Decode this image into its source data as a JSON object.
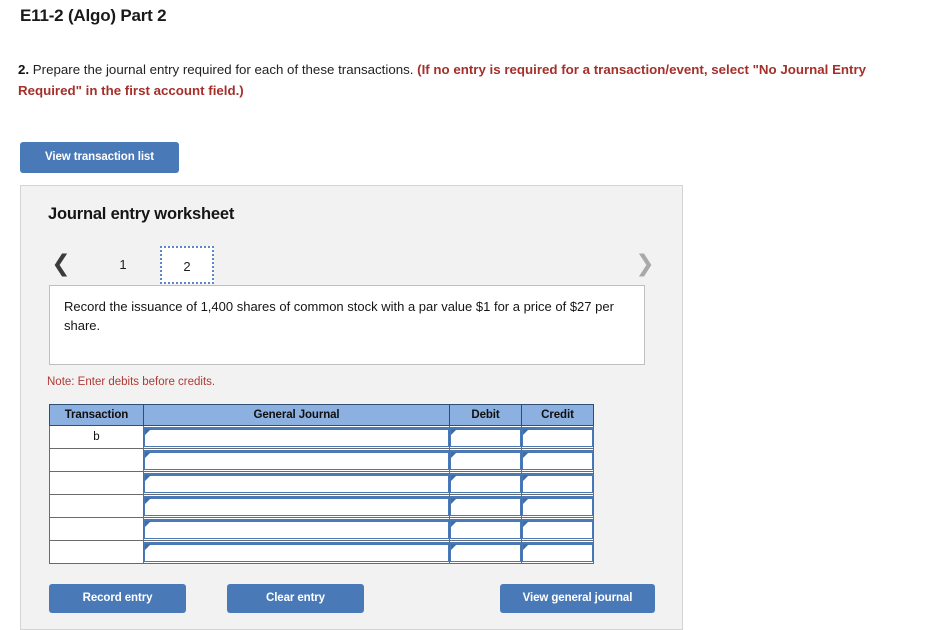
{
  "page_title": "E11-2 (Algo) Part 2",
  "instruction": {
    "number": "2.",
    "text": "Prepare the journal entry required for each of these transactions.",
    "hint": "(If no entry is required for a transaction/event, select \"No Journal Entry Required\" in the first account field.)"
  },
  "view_transaction_button": "View transaction list",
  "worksheet": {
    "title": "Journal entry worksheet",
    "pager": {
      "prev_icon": "chevron-left-icon",
      "next_icon": "chevron-right-icon",
      "tabs": [
        {
          "label": "1",
          "active": false
        },
        {
          "label": "2",
          "active": true
        }
      ]
    },
    "description": "Record the issuance of 1,400 shares of common stock with a par value $1 for a price of $27 per share.",
    "note": "Note: Enter debits before credits.",
    "table": {
      "headers": [
        "Transaction",
        "General Journal",
        "Debit",
        "Credit"
      ],
      "rows": [
        {
          "transaction": "b",
          "general_journal": "",
          "debit": "",
          "credit": ""
        },
        {
          "transaction": "",
          "general_journal": "",
          "debit": "",
          "credit": ""
        },
        {
          "transaction": "",
          "general_journal": "",
          "debit": "",
          "credit": ""
        },
        {
          "transaction": "",
          "general_journal": "",
          "debit": "",
          "credit": ""
        },
        {
          "transaction": "",
          "general_journal": "",
          "debit": "",
          "credit": ""
        },
        {
          "transaction": "",
          "general_journal": "",
          "debit": "",
          "credit": ""
        }
      ]
    },
    "buttons": {
      "record": "Record entry",
      "clear": "Clear entry",
      "journal": "View general journal"
    }
  },
  "colors": {
    "button_blue": "#4a79b8",
    "table_header_blue": "#8cb0e0",
    "hint_red": "#a52f2a",
    "note_red": "#b03a34",
    "panel_bg": "#f2f2f2",
    "active_tab_border": "#5b87c4"
  }
}
